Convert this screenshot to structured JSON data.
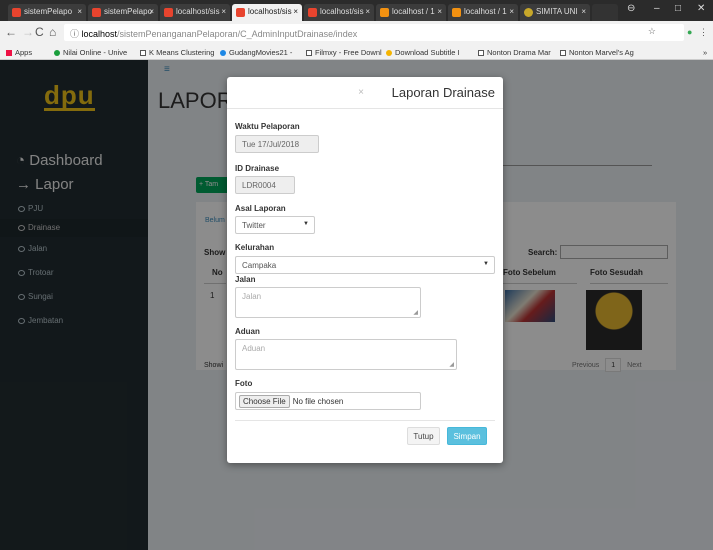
{
  "browser": {
    "tabs": [
      {
        "label": "sistemPelapo",
        "fav": "#e8442e"
      },
      {
        "label": "sistemPelapo",
        "fav": "#e8442e"
      },
      {
        "label": "localhost/sis",
        "fav": "#e8442e"
      },
      {
        "label": "localhost/sis",
        "fav": "#e8442e"
      },
      {
        "label": "localhost/sis",
        "fav": "#e8442e"
      },
      {
        "label": "localhost / 1",
        "fav": "#f29111"
      },
      {
        "label": "localhost / 1",
        "fav": "#f29111"
      },
      {
        "label": "SIMITA UNI",
        "fav": "#c8a82a"
      }
    ],
    "url_host": "localhost",
    "url_path": "/sistemPenangananPelaporan/C_AdminInputDrainase/index",
    "bookmarks": [
      {
        "label": "Apps",
        "color": "#e14"
      },
      {
        "label": "Nilai Online - Unive",
        "color": "#1a9e3c"
      },
      {
        "label": "K Means Clustering",
        "color": "#888"
      },
      {
        "label": "GudangMovies21 -",
        "color": "#1e88e5"
      },
      {
        "label": "Filmxy - Free Downl",
        "color": "#888"
      },
      {
        "label": "Download Subtitle I",
        "color": "#f5b400"
      },
      {
        "label": "Nonton Drama Mar",
        "color": "#888"
      },
      {
        "label": "Nonton Marvel's Ag",
        "color": "#888"
      }
    ]
  },
  "sidebar": {
    "logo": "dpu",
    "dashboard": "Dashboard",
    "lapor": "Lapor",
    "items": [
      "PJU",
      "Drainase",
      "Jalan",
      "Trotoar",
      "Sungai",
      "Jembatan"
    ]
  },
  "background": {
    "title": "LAPOR",
    "add_button": "+ Tam",
    "tab": "Belum",
    "show": "Show",
    "search_label": "Search:",
    "col_no": "No",
    "col_foto_sebelum": "Foto Sebelum",
    "col_foto_sesudah": "Foto Sesudah",
    "row_no": "1",
    "showing": "Showi",
    "previous": "Previous",
    "page": "1",
    "next": "Next"
  },
  "modal": {
    "title": "Laporan Drainase",
    "close": "×",
    "waktu_label": "Waktu Pelaporan",
    "waktu_value": "Tue 17/Jul/2018",
    "id_label": "ID Drainase",
    "id_value": "LDR0004",
    "asal_label": "Asal Laporan",
    "asal_value": "Twitter",
    "kelurahan_label": "Kelurahan",
    "kelurahan_value": "Campaka",
    "jalan_label": "Jalan",
    "jalan_placeholder": "Jalan",
    "aduan_label": "Aduan",
    "aduan_placeholder": "Aduan",
    "foto_label": "Foto",
    "choose_file": "Choose File",
    "no_file": "No file chosen",
    "tutup": "Tutup",
    "simpan": "Simpan"
  }
}
